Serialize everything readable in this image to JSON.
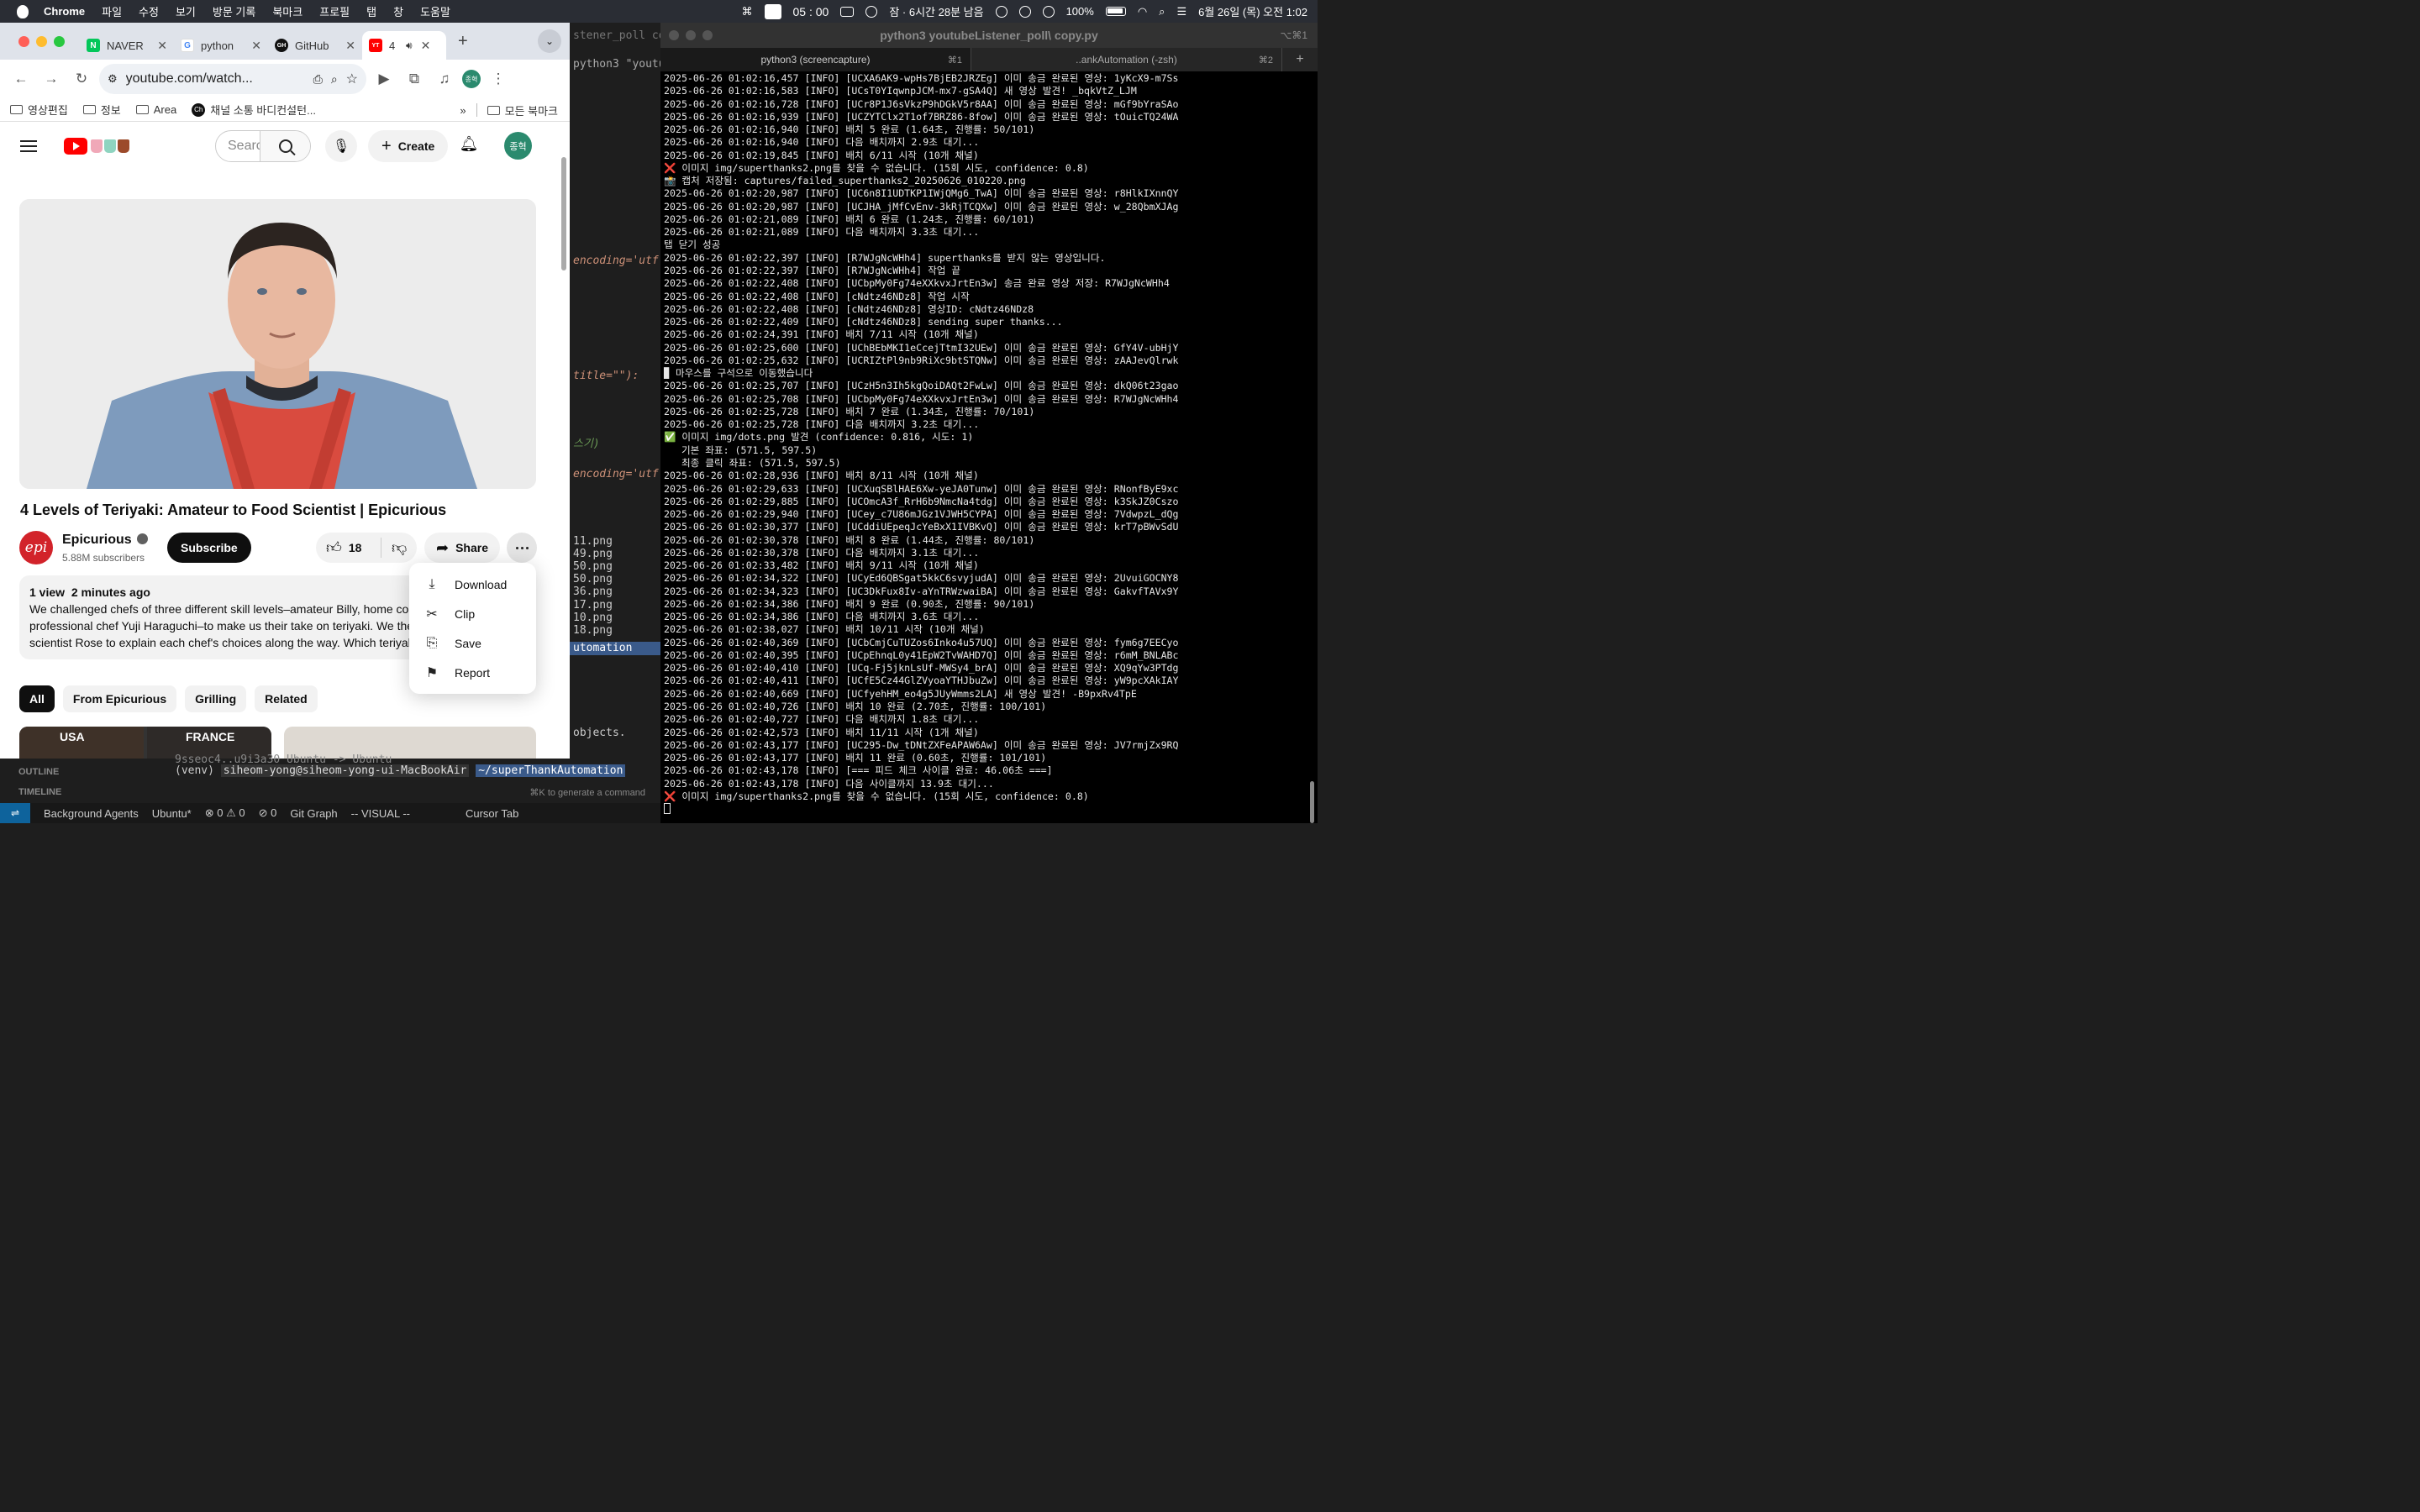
{
  "menubar": {
    "app": "Chrome",
    "items": [
      "파일",
      "수정",
      "보기",
      "방문 기록",
      "북마크",
      "프로필",
      "탭",
      "창",
      "도움말"
    ],
    "timer": "05 : 00",
    "sleep_text": "잠 · 6시간 28분 남음",
    "battery": "100%",
    "datetime": "6월 26일 (목) 오전 1:02"
  },
  "chrome": {
    "tabs": [
      {
        "label": "NAVER",
        "favicon": "N",
        "color": "#03c75a"
      },
      {
        "label": "python",
        "favicon": "G",
        "color": "#4285f4"
      },
      {
        "label": "GitHub",
        "favicon": "GH",
        "color": "#111111"
      },
      {
        "label": "4",
        "favicon": "YT",
        "color": "#ff0000"
      }
    ],
    "url": "youtube.com/watch...",
    "profile_initials": "종혁",
    "bookmarks": [
      "영상편집",
      "정보",
      "Area",
      "채널 소통 바디컨설턴..."
    ],
    "all_bookmarks": "모든 북마크"
  },
  "youtube": {
    "search_placeholder": "Search",
    "create_label": "Create",
    "avatar_initials": "종혁",
    "title": "4 Levels of Teriyaki: Amateur to Food Scientist | Epicurious",
    "channel": "Epicurious",
    "channel_logo": "epi",
    "subscribers": "5.88M subscribers",
    "subscribe_label": "Subscribe",
    "likes": "18",
    "share_label": "Share",
    "views": "1 view",
    "posted": "2 minutes ago",
    "description": [
      "We challenged chefs of three different skill levels–amateur Billy, home coo",
      "professional chef Yuji Haraguchi–to make us their take on teriyaki. We ther",
      "scientist Rose to explain each chef's choices along the way. Which teriyaki"
    ],
    "chips": [
      "All",
      "From Epicurious",
      "Grilling",
      "Related"
    ],
    "thumb_labels": [
      "USA",
      "FRANCE"
    ],
    "menu": [
      {
        "label": "Download",
        "icon": "download-icon",
        "glyph": "⤓"
      },
      {
        "label": "Clip",
        "icon": "scissors-icon",
        "glyph": "✂"
      },
      {
        "label": "Save",
        "icon": "bookmark-icon",
        "glyph": "⎘"
      },
      {
        "label": "Report",
        "icon": "flag-icon",
        "glyph": "⚑"
      }
    ]
  },
  "editor": {
    "tab_title": "stener_poll copy.p",
    "lines": [
      "python3 \"youtube",
      "encoding='utf",
      "title=\"\"):",
      "스기)",
      "encoding='utf",
      "11.png",
      "49.png",
      "50.png",
      "50.png",
      "36.png",
      "17.png",
      "10.png",
      "18.png",
      "utomation",
      "objects."
    ],
    "bottom": {
      "outline": "OUTLINE",
      "timeline": "TIMELINE",
      "prev_line": "9sseoc4..u9i3a30  Ubuntu -> Ubuntu",
      "prompt_env": "(venv)",
      "prompt_user": "siheom-yong@siheom-yong-ui-MacBookAir",
      "prompt_dir": "~/superThankAutomation",
      "hint": "⌘K to generate a command"
    },
    "status": [
      "Background Agents",
      "Ubuntu*",
      "⊗ 0 ⚠ 0",
      "⊘ 0",
      "Git Graph",
      "-- VISUAL --",
      "Cursor Tab"
    ]
  },
  "terminal": {
    "title": "python3 youtubeListener_poll\\ copy.py",
    "shortcut": "⌥⌘1",
    "tabs": [
      {
        "label": "python3 (screencapture)",
        "kb": "⌘1"
      },
      {
        "label": "..ankAutomation (-zsh)",
        "kb": "⌘2"
      }
    ],
    "lines": [
      "2025-06-26 01:02:16,457 [INFO] [UCXA6AK9-wpHs7BjEB2JRZEg] 이미 송금 완료된 영상: 1yKcX9-m7Ss",
      "2025-06-26 01:02:16,583 [INFO] [UCsT0YIqwnpJCM-mx7-gSA4Q] 새 영상 발견! _bqkVtZ_LJM",
      "2025-06-26 01:02:16,728 [INFO] [UCr8P1J6sVkzP9hDGkV5r8AA] 이미 송금 완료된 영상: mGf9bYraSAo",
      "2025-06-26 01:02:16,939 [INFO] [UCZYTClx2T1of7BRZ86-8fow] 이미 송금 완료된 영상: tOuicTQ24WA",
      "2025-06-26 01:02:16,940 [INFO] 배치 5 완료 (1.64초, 진행률: 50/101)",
      "2025-06-26 01:02:16,940 [INFO] 다음 배치까지 2.9초 대기...",
      "2025-06-26 01:02:19,845 [INFO] 배치 6/11 시작 (10개 채널)",
      "❌ 이미지 img/superthanks2.png를 찾을 수 없습니다. (15회 시도, confidence: 0.8)",
      "📸 캡처 저장됨: captures/failed_superthanks2_20250626_010220.png",
      "2025-06-26 01:02:20,987 [INFO] [UC6n8I1UDTKP1IWjQMg6_TwA] 이미 송금 완료된 영상: r8HlkIXnnQY",
      "2025-06-26 01:02:20,987 [INFO] [UCJHA_jMfCvEnv-3kRjTCQXw] 이미 송금 완료된 영상: w_28QbmXJAg",
      "2025-06-26 01:02:21,089 [INFO] 배치 6 완료 (1.24초, 진행률: 60/101)",
      "2025-06-26 01:02:21,089 [INFO] 다음 배치까지 3.3초 대기...",
      "탭 닫기 성공",
      "2025-06-26 01:02:22,397 [INFO] [R7WJgNcWHh4] superthanks를 받지 않는 영상입니다.",
      "2025-06-26 01:02:22,397 [INFO] [R7WJgNcWHh4] 작업 끝",
      "2025-06-26 01:02:22,408 [INFO] [UCbpMy0Fg74eXXkvxJrtEn3w] 송금 완료 영상 저장: R7WJgNcWHh4",
      "2025-06-26 01:02:22,408 [INFO] [cNdtz46NDz8] 작업 시작",
      "2025-06-26 01:02:22,408 [INFO] [cNdtz46NDz8] 영상ID: cNdtz46NDz8",
      "2025-06-26 01:02:22,409 [INFO] [cNdtz46NDz8] sending super thanks...",
      "2025-06-26 01:02:24,391 [INFO] 배치 7/11 시작 (10개 채널)",
      "2025-06-26 01:02:25,600 [INFO] [UChBEbMKI1eCcejTtmI32UEw] 이미 송금 완료된 영상: GfY4V-ubHjY",
      "2025-06-26 01:02:25,632 [INFO] [UCRIZtPl9nb9RiXc9btSTQNw] 이미 송금 완료된 영상: zAAJevQlrwk",
      "▉ 마우스를 구석으로 이동했습니다",
      "2025-06-26 01:02:25,707 [INFO] [UCzH5n3Ih5kgQoiDAQt2FwLw] 이미 송금 완료된 영상: dkQ06t23gao",
      "2025-06-26 01:02:25,708 [INFO] [UCbpMy0Fg74eXXkvxJrtEn3w] 이미 송금 완료된 영상: R7WJgNcWHh4",
      "2025-06-26 01:02:25,728 [INFO] 배치 7 완료 (1.34초, 진행률: 70/101)",
      "2025-06-26 01:02:25,728 [INFO] 다음 배치까지 3.2초 대기...",
      "✅ 이미지 img/dots.png 발견 (confidence: 0.816, 시도: 1)",
      "   기본 좌표: (571.5, 597.5)",
      "   최종 클릭 좌표: (571.5, 597.5)",
      "2025-06-26 01:02:28,936 [INFO] 배치 8/11 시작 (10개 채널)",
      "2025-06-26 01:02:29,633 [INFO] [UCXuqSBlHAE6Xw-yeJA0Tunw] 이미 송금 완료된 영상: RNonfByE9xc",
      "2025-06-26 01:02:29,885 [INFO] [UCOmcA3f_RrH6b9NmcNa4tdg] 이미 송금 완료된 영상: k3SkJZ0Cszo",
      "2025-06-26 01:02:29,940 [INFO] [UCey_c7U86mJGz1VJWH5CYPA] 이미 송금 완료된 영상: 7VdwpzL_dQg",
      "2025-06-26 01:02:30,377 [INFO] [UCddiUEpeqJcYeBxX1IVBKvQ] 이미 송금 완료된 영상: krT7pBWvSdU",
      "2025-06-26 01:02:30,378 [INFO] 배치 8 완료 (1.44초, 진행률: 80/101)",
      "2025-06-26 01:02:30,378 [INFO] 다음 배치까지 3.1초 대기...",
      "2025-06-26 01:02:33,482 [INFO] 배치 9/11 시작 (10개 채널)",
      "2025-06-26 01:02:34,322 [INFO] [UCyEd6QBSgat5kkC6svyjudA] 이미 송금 완료된 영상: 2UvuiGOCNY8",
      "2025-06-26 01:02:34,323 [INFO] [UC3DkFux8Iv-aYnTRWzwaiBA] 이미 송금 완료된 영상: GakvfTAVx9Y",
      "2025-06-26 01:02:34,386 [INFO] 배치 9 완료 (0.90초, 진행률: 90/101)",
      "2025-06-26 01:02:34,386 [INFO] 다음 배치까지 3.6초 대기...",
      "2025-06-26 01:02:38,027 [INFO] 배치 10/11 시작 (10개 채널)",
      "2025-06-26 01:02:40,369 [INFO] [UCbCmjCuTUZos6Inko4u57UQ] 이미 송금 완료된 영상: fym6g7EECyo",
      "2025-06-26 01:02:40,395 [INFO] [UCpEhnqL0y41EpW2TvWAHD7Q] 이미 송금 완료된 영상: r6mM_BNLABc",
      "2025-06-26 01:02:40,410 [INFO] [UCq-Fj5jknLsUf-MWSy4_brA] 이미 송금 완료된 영상: XQ9qYw3PTdg",
      "2025-06-26 01:02:40,411 [INFO] [UCfE5Cz44GlZVyoaYTHJbuZw] 이미 송금 완료된 영상: yW9pcXAkIAY",
      "2025-06-26 01:02:40,669 [INFO] [UCfyehHM_eo4g5JUyWmms2LA] 새 영상 발견! -B9pxRv4TpE",
      "2025-06-26 01:02:40,726 [INFO] 배치 10 완료 (2.70초, 진행률: 100/101)",
      "2025-06-26 01:02:40,727 [INFO] 다음 배치까지 1.8초 대기...",
      "2025-06-26 01:02:42,573 [INFO] 배치 11/11 시작 (1개 채널)",
      "2025-06-26 01:02:43,177 [INFO] [UC295-Dw_tDNtZXFeAPAW6Aw] 이미 송금 완료된 영상: JV7rmjZx9RQ",
      "2025-06-26 01:02:43,177 [INFO] 배치 11 완료 (0.60초, 진행률: 101/101)",
      "2025-06-26 01:02:43,178 [INFO] [=== 피드 체크 사이클 완료: 46.06초 ===]",
      "2025-06-26 01:02:43,178 [INFO] 다음 사이클까지 13.9초 대기...",
      "❌ 이미지 img/superthanks2.png를 찾을 수 없습니다. (15회 시도, confidence: 0.8)"
    ]
  }
}
